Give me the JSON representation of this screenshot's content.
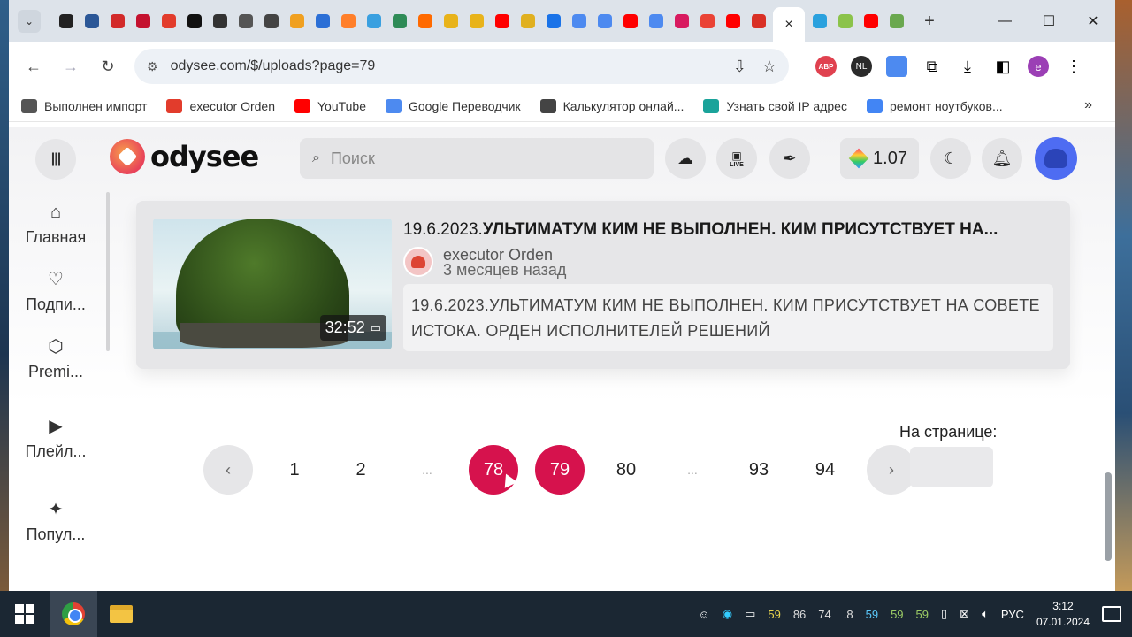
{
  "browser": {
    "active_tab_close": "×",
    "new_tab": "+",
    "window_controls": {
      "minimize": "—",
      "maximize": "☐",
      "close": "✕"
    },
    "tab_icon_colors": [
      "#222222",
      "#2b5797",
      "#d22a2a",
      "#c4122f",
      "#e23c2c",
      "#111111",
      "#333333",
      "#555555",
      "#444444",
      "#f0a020",
      "#2b6fd6",
      "#ff7f2a",
      "#3aa0e0",
      "#2e8b57",
      "#ff6a00",
      "#e8b31a",
      "#e8b31a",
      "#ff0000",
      "#e0b020",
      "#1a73e8",
      "#4d8af0",
      "#4d8af0",
      "#ff0000",
      "#4d8af0",
      "#d81b60",
      "#ea4335",
      "#ff0000",
      "#d93025",
      "#2aa1de",
      "#8bc34a",
      "#ff0000",
      "#6aa84f"
    ],
    "url": "odysee.com/$/uploads?page=79",
    "back": "←",
    "forward": "→",
    "reload": "↻",
    "extensions": {
      "abp": "ABP",
      "nl": "NL",
      "profile": "e"
    }
  },
  "bookmarks": [
    {
      "label": "Выполнен импорт",
      "color": "#555555"
    },
    {
      "label": "executor Orden",
      "color": "#e23c2c"
    },
    {
      "label": "YouTube",
      "color": "#ff0000"
    },
    {
      "label": "Google Переводчик",
      "color": "#4d8af0"
    },
    {
      "label": "Калькулятор онлай...",
      "color": "#444444"
    },
    {
      "label": "Узнать свой IP адрес",
      "color": "#1aa39a"
    },
    {
      "label": "ремонт ноутбуков...",
      "color": "#4285f4"
    }
  ],
  "bookmarks_more": "»",
  "odysee": {
    "menu_icon": "|||",
    "logo_text": "odysee",
    "search_placeholder": "Поиск",
    "live_label": "LIVE",
    "credits": "1.07",
    "sidebar": [
      {
        "icon": "⌂",
        "label": "Главная"
      },
      {
        "icon": "♡",
        "label": "Подпи..."
      },
      {
        "icon": "⬡",
        "label": "Premi..."
      },
      {
        "icon": "▶",
        "label": "Плейл..."
      },
      {
        "icon": "✦",
        "label": "Попул..."
      }
    ],
    "video": {
      "title_date": "19.6.2023.",
      "title_rest": "УЛЬТИМАТУМ КИМ НЕ ВЫПОЛНЕН. КИМ ПРИСУТСТВУЕТ НА...",
      "duration": "32:52",
      "channel": "executor Orden",
      "time_ago": "3 месяцев назад",
      "description": "19.6.2023.УЛЬТИМАТУМ КИМ НЕ ВЫПОЛНЕН. КИМ ПРИСУТСТВУЕТ НА СОВЕТЕ ИСТОКА. ОРДЕН ИСПОЛНИТЕЛЕЙ РЕШЕНИЙ"
    },
    "pagination": {
      "prev": "‹",
      "next": "›",
      "pages": [
        "1",
        "2",
        "...",
        "78",
        "79",
        "80",
        "...",
        "93",
        "94"
      ],
      "current": "79",
      "per_page_label": "На странице:"
    },
    "accent_color": "#d6124d"
  },
  "taskbar": {
    "tray_numbers": [
      "59",
      "86",
      "74",
      ".8",
      "59",
      "59",
      "59"
    ],
    "language": "РУС",
    "time": "3:12",
    "date": "07.01.2024"
  }
}
